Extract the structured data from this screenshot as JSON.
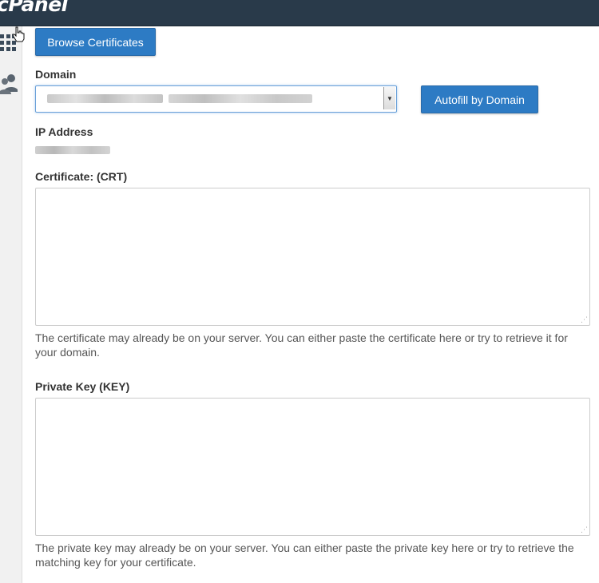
{
  "app": {
    "logo_text": "cPanel"
  },
  "sidebar": {
    "items": [
      {
        "icon": "grid-icon"
      },
      {
        "icon": "users-icon"
      }
    ]
  },
  "form": {
    "browse_button": "Browse Certificates",
    "domain": {
      "label": "Domain",
      "selected_value": "[blurred domain]"
    },
    "autofill_button": "Autofill by Domain",
    "ip_address": {
      "label": "IP Address",
      "value": "[blurred ip]"
    },
    "certificate": {
      "label": "Certificate: (CRT)",
      "value": "",
      "help": "The certificate may already be on your server. You can either paste the certificate here or try to retrieve it for your domain."
    },
    "private_key": {
      "label": "Private Key (KEY)",
      "value": "",
      "help": "The private key may already be on your server. You can either paste the private key here or try to retrieve the matching key for your certificate."
    }
  },
  "colors": {
    "topbar": "#293a4a",
    "primary_button": "#2d7bc4",
    "focus_border": "#6aa0d8"
  }
}
